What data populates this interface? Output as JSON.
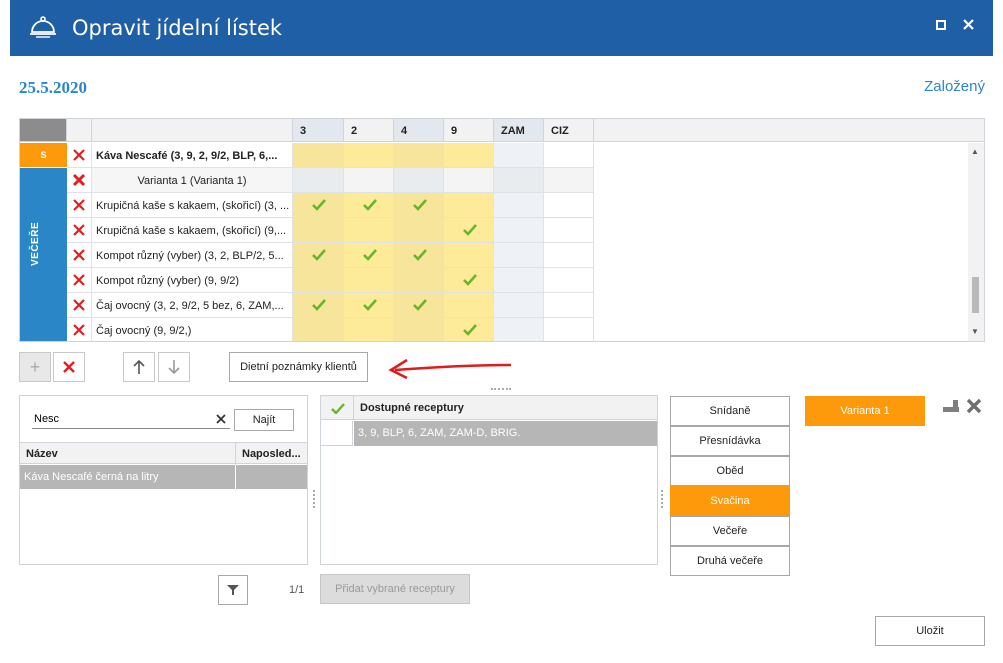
{
  "window": {
    "title": "Opravit jídelní lístek"
  },
  "header": {
    "date": "25.5.2020",
    "status": "Založený"
  },
  "grid": {
    "columns": [
      "3",
      "2",
      "4",
      "9",
      "ZAM",
      "CIZ"
    ],
    "group_s_label": "S",
    "group_vecere_label": "VEČEŘE",
    "rows": [
      {
        "text": "Káva Nescafé (3, 9, 2, 9/2, BLP, 6,...",
        "bold": true,
        "checks": [
          0,
          0,
          0,
          0,
          0,
          0
        ]
      },
      {
        "text": "Varianta 1 (Varianta 1)",
        "variant": true,
        "checks": [
          0,
          0,
          0,
          0,
          0,
          0
        ]
      },
      {
        "text": "Krupičná kaše s kakaem, (skořicí) (3, ...",
        "checks": [
          1,
          1,
          1,
          0,
          0,
          0
        ]
      },
      {
        "text": "Krupičná kaše s kakaem, (skořicí) (9,...",
        "checks": [
          0,
          0,
          0,
          1,
          0,
          0
        ]
      },
      {
        "text": "Kompot různý (vyber) (3, 2, BLP/2, 5...",
        "checks": [
          1,
          1,
          1,
          0,
          0,
          0
        ]
      },
      {
        "text": "Kompot různý (vyber) (9, 9/2)",
        "checks": [
          0,
          0,
          0,
          1,
          0,
          0
        ]
      },
      {
        "text": "Čaj ovocný (3, 2, 9/2, 5 bez, 6, ZAM,...",
        "checks": [
          1,
          1,
          1,
          0,
          0,
          0
        ]
      },
      {
        "text": "Čaj ovocný (9, 9/2,)",
        "checks": [
          0,
          0,
          0,
          1,
          0,
          0
        ]
      }
    ]
  },
  "toolbar": {
    "diet_notes_label": "Dietní poznámky klientů"
  },
  "search": {
    "value": "Nesc",
    "find_label": "Najít",
    "col_name": "Název",
    "col_last": "Naposled...",
    "results": [
      "Káva Nescafé černá na litry"
    ]
  },
  "recipes": {
    "header": "Dostupné receptury",
    "rows": [
      "3, 9, BLP, 6, ZAM, ZAM-D, BRIG."
    ]
  },
  "pager": {
    "text": "1/1",
    "add_label": "Přidat vybrané receptury"
  },
  "meals": {
    "items": [
      "Snídaně",
      "Přesnídávka",
      "Oběd",
      "Svačina",
      "Večeře",
      "Druhá večeře"
    ],
    "active": "Svačina"
  },
  "variant": {
    "label": "Varianta 1"
  },
  "footer": {
    "save_label": "Uložit"
  },
  "colors": {
    "titlebar": "#1f5fa6",
    "accent": "#fc9a0c",
    "link": "#2b86c8",
    "check": "#6ab42c",
    "delete": "#e02020"
  }
}
